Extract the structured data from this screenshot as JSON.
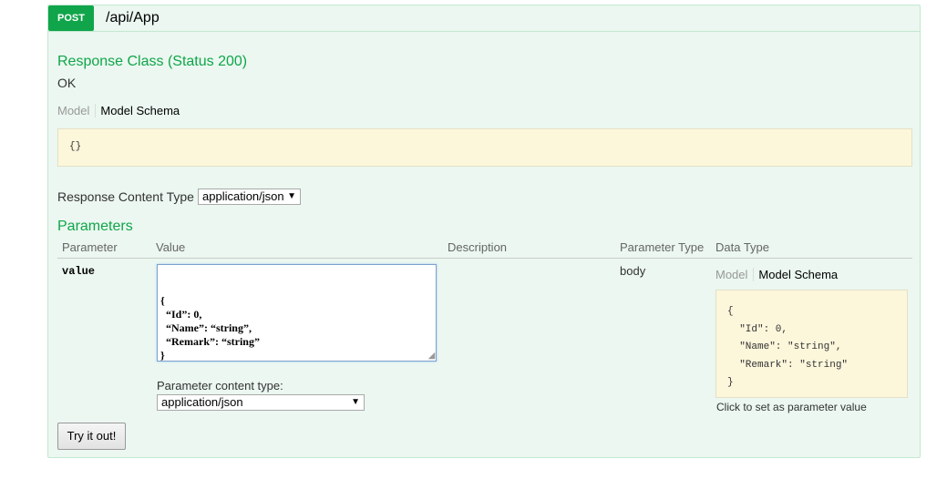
{
  "operation": {
    "method": "POST",
    "path": "/api/App"
  },
  "response": {
    "title": "Response Class (Status 200)",
    "status_text": "OK",
    "tabs": {
      "model": "Model",
      "schema": "Model Schema"
    },
    "schema_snippet": "{}"
  },
  "response_content_type": {
    "label": "Response Content Type",
    "selected": "application/json"
  },
  "parameters": {
    "title": "Parameters",
    "columns": [
      "Parameter",
      "Value",
      "Description",
      "Parameter Type",
      "Data Type"
    ],
    "rows": [
      {
        "name": "value",
        "value_lines": [
          "{",
          "  “Id”: 0,",
          "  “Name”: “string”,",
          "  “Remark”: “string”",
          "}"
        ],
        "description": "",
        "param_type": "body",
        "data_type_tabs": {
          "model": "Model",
          "schema": "Model Schema"
        },
        "schema_lines": [
          "{",
          "  \"Id\": 0,",
          "  \"Name\": \"string\",",
          "  \"Remark\": \"string\"",
          "}"
        ],
        "hint": "Click to set as parameter value",
        "content_type_label": "Parameter content type:",
        "content_type_selected": "application/json"
      }
    ]
  },
  "actions": {
    "try_label": "Try it out!"
  },
  "colors": {
    "accent": "#10a54a",
    "panel_bg": "#ebf7f0",
    "snippet_bg": "#fcf6db"
  }
}
